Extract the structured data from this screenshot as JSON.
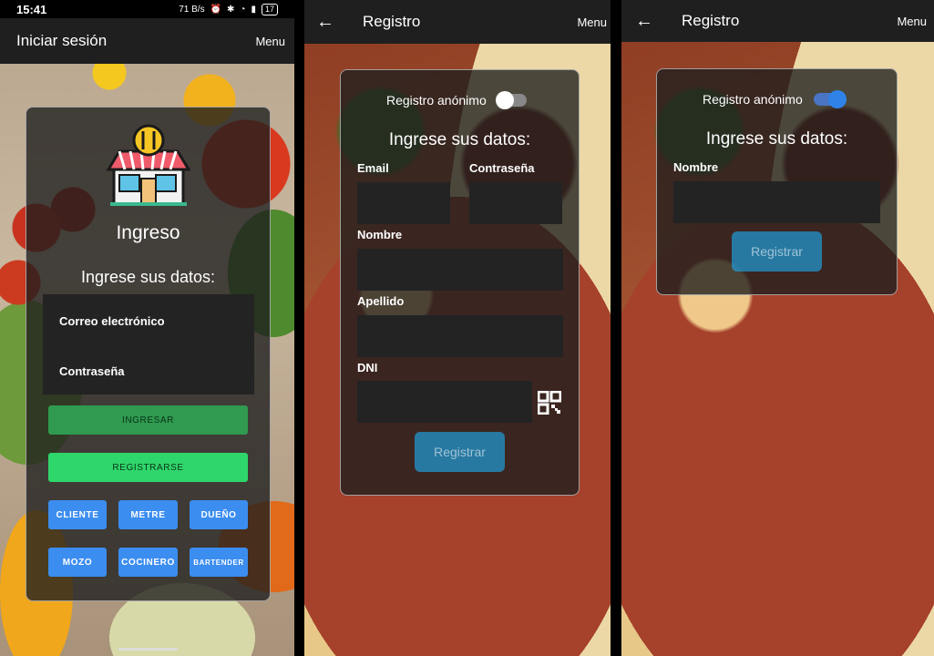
{
  "status_bar": {
    "time": "15:41",
    "net": "71 B/s",
    "battery": "17"
  },
  "login": {
    "title": "Iniciar sesión",
    "menu": "Menu",
    "heading": "Ingreso",
    "subheading": "Ingrese sus datos:",
    "email_placeholder": "Correo electrónico",
    "password_placeholder": "Contraseña",
    "btn_login": "INGRESAR",
    "btn_register": "REGISTRARSE",
    "roles": [
      "CLIENTE",
      "METRE",
      "DUEÑO",
      "MOZO",
      "COCINERO",
      "BARTENDER"
    ]
  },
  "register_full": {
    "title": "Registro",
    "menu": "Menu",
    "anon_label": "Registro anónimo",
    "anon_on": false,
    "heading": "Ingrese sus datos:",
    "labels": {
      "email": "Email",
      "password": "Contraseña",
      "name": "Nombre",
      "surname": "Apellido",
      "dni": "DNI"
    },
    "submit": "Registrar"
  },
  "register_anon": {
    "title": "Registro",
    "menu": "Menu",
    "anon_label": "Registro anónimo",
    "anon_on": true,
    "heading": "Ingrese sus datos:",
    "labels": {
      "name": "Nombre"
    },
    "submit": "Registrar"
  },
  "colors": {
    "appbar": "#1f1f1f",
    "green": "#2fd66b",
    "blue": "#3b8df0",
    "toggle_on": "#2f83e8"
  },
  "icons": [
    "restaurant-logo-icon",
    "back-arrow-icon",
    "qr-code-icon"
  ]
}
